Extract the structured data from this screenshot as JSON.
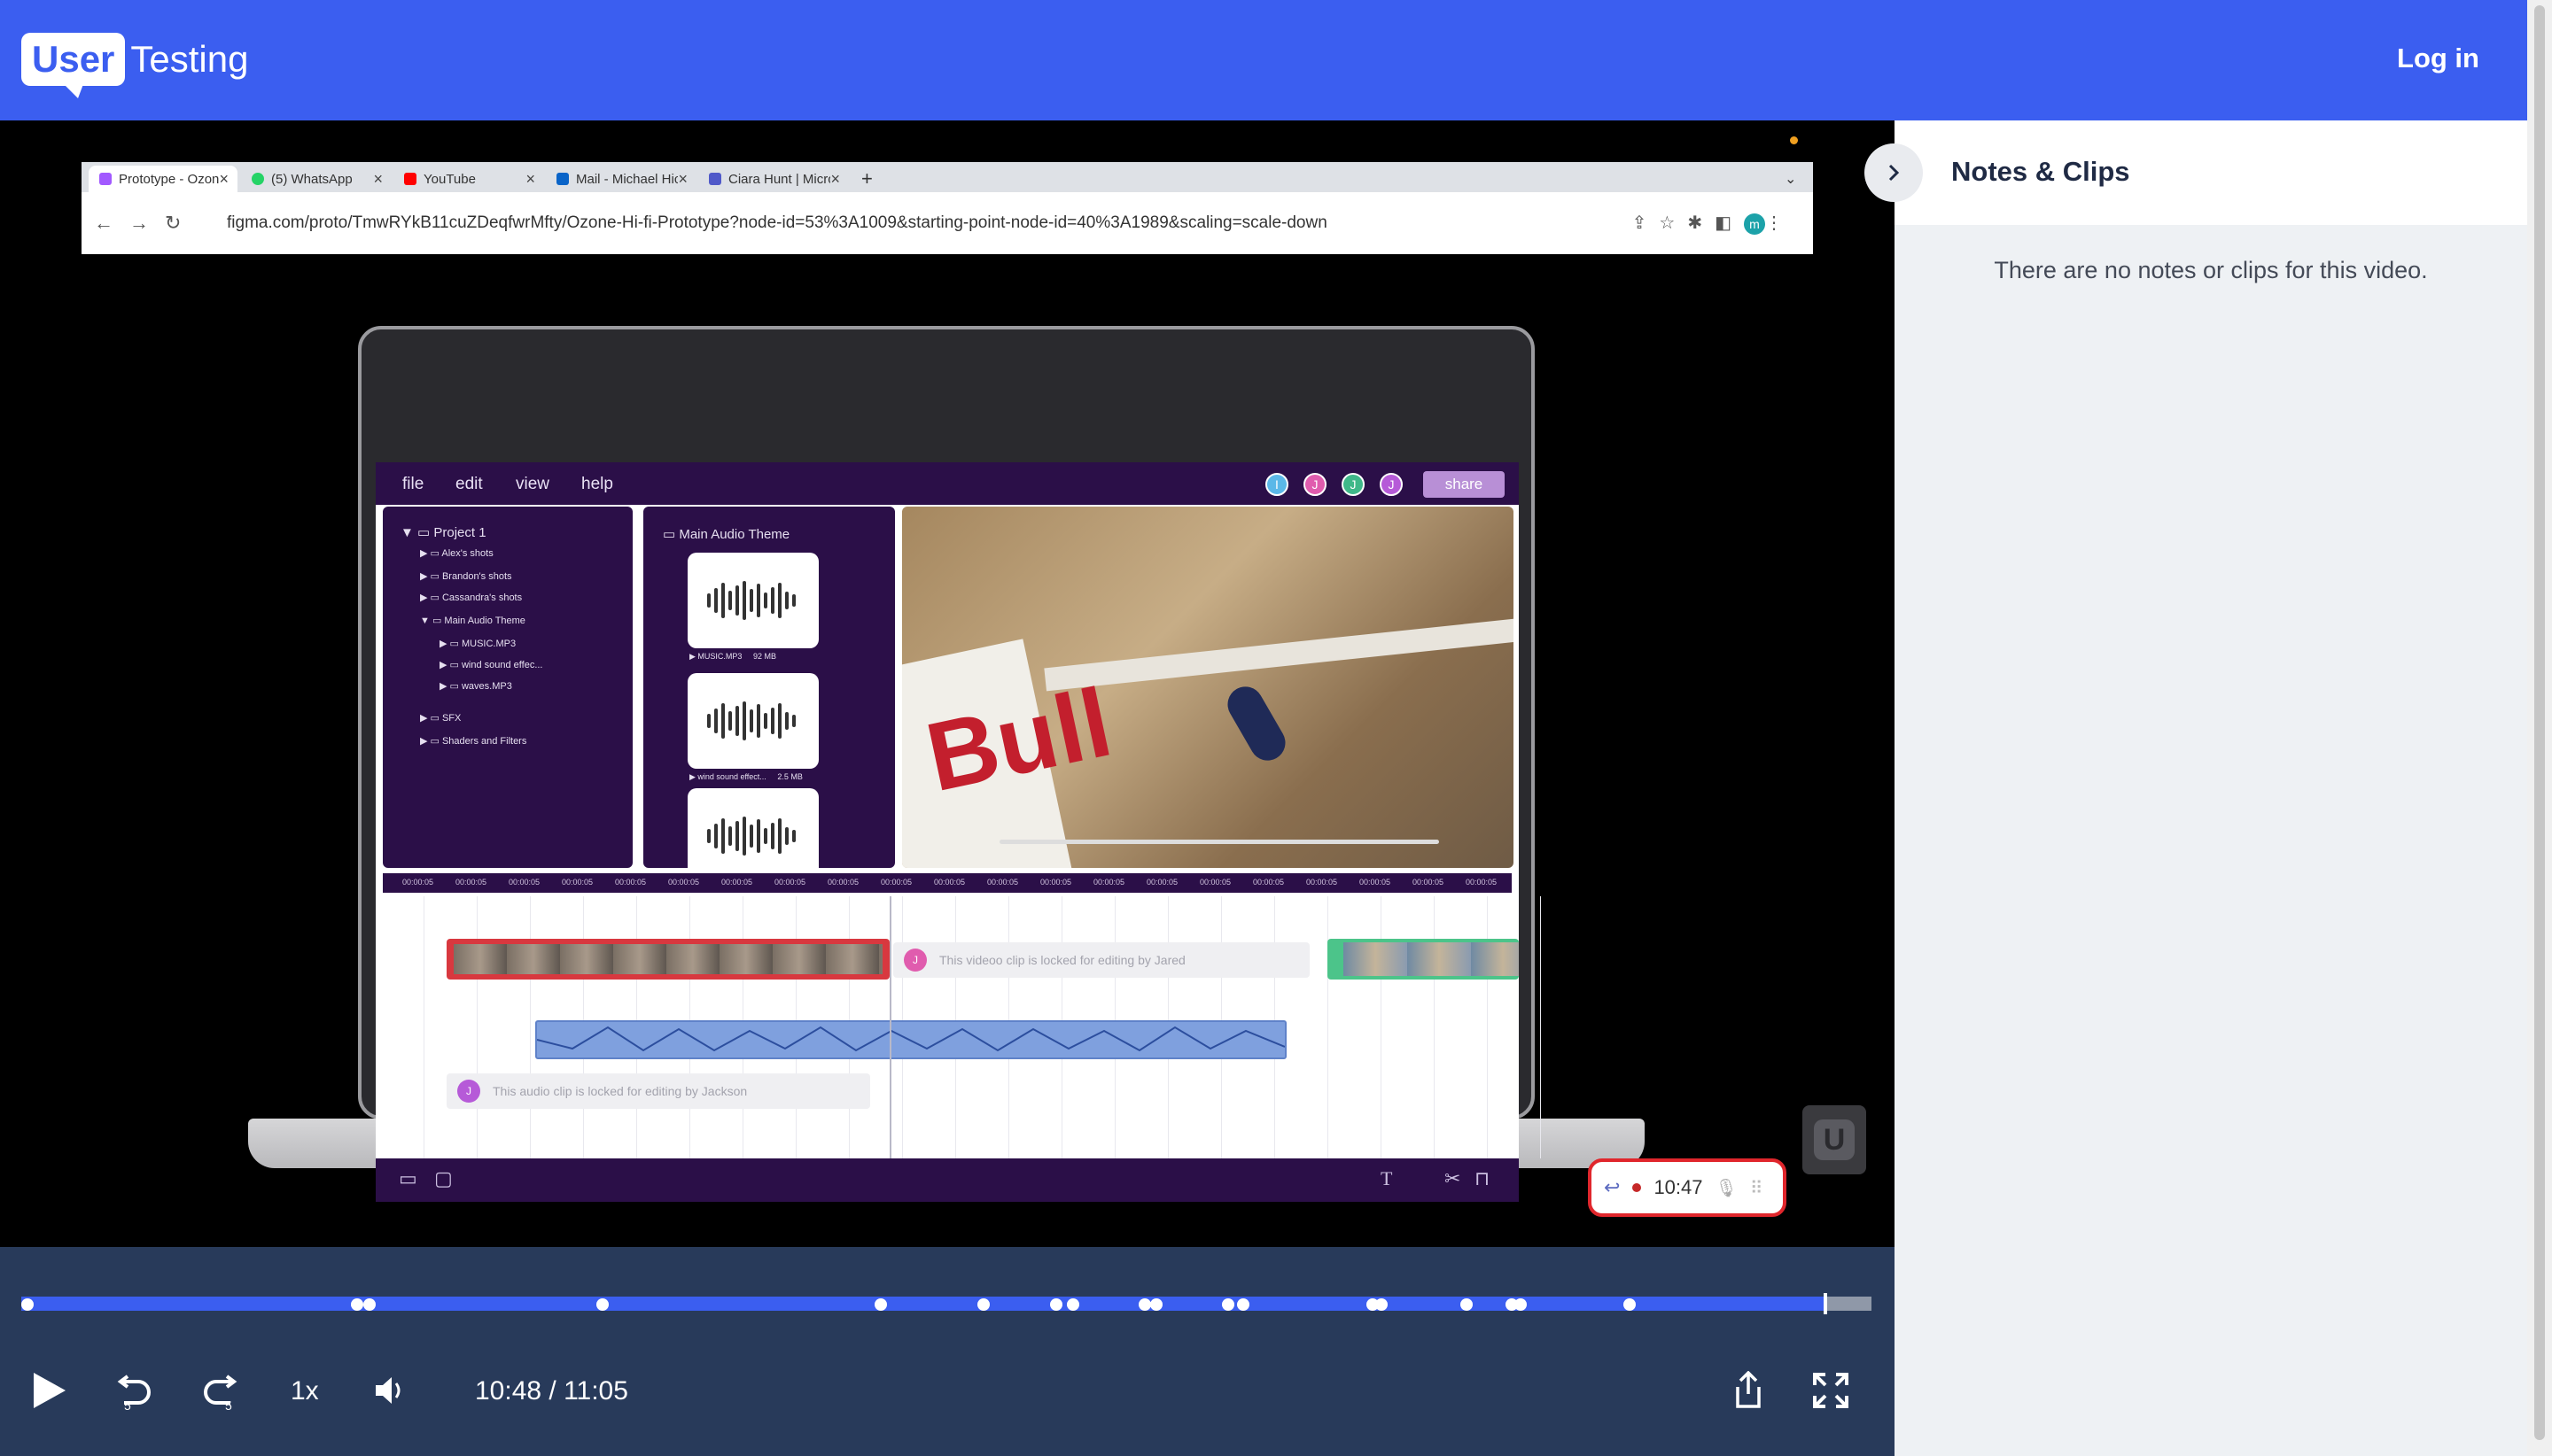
{
  "header": {
    "logo_user": "User",
    "logo_testing": "Testing",
    "login_label": "Log in"
  },
  "browser": {
    "tabs": [
      {
        "title": "Prototype - Ozone Hi-fi Prot",
        "icon": "figma-icon",
        "active": true
      },
      {
        "title": "(5) WhatsApp",
        "icon": "whatsapp-icon"
      },
      {
        "title": "YouTube",
        "icon": "youtube-icon"
      },
      {
        "title": "Mail - Michael Hickman - Outlo",
        "icon": "outlook-icon"
      },
      {
        "title": "Ciara Hunt | Microsoft Teams",
        "icon": "teams-icon"
      }
    ],
    "url": "figma.com/proto/TmwRYkB11cuZDeqfwrMfty/Ozone-Hi-fi-Prototype?node-id=53%3A1009&starting-point-node-id=40%3A1989&scaling=scale-down",
    "profile_initial": "m"
  },
  "app": {
    "menus": [
      "file",
      "edit",
      "view",
      "help"
    ],
    "avatars": [
      {
        "initial": "I",
        "color": "#5bb8e8"
      },
      {
        "initial": "J",
        "color": "#e05cae"
      },
      {
        "initial": "J",
        "color": "#3fb889"
      },
      {
        "initial": "J",
        "color": "#b65ad8"
      }
    ],
    "share_label": "share",
    "project_tree": [
      {
        "label": "Project 1",
        "level": 0,
        "arrow": "▼"
      },
      {
        "label": "Alex's shots",
        "level": 1,
        "arrow": "▶"
      },
      {
        "label": "Brandon's shots",
        "level": 1,
        "arrow": "▶"
      },
      {
        "label": "Cassandra's shots",
        "level": 1,
        "arrow": "▶"
      },
      {
        "label": "Main Audio Theme",
        "level": 1,
        "arrow": "▼"
      },
      {
        "label": "MUSIC.MP3",
        "level": 2,
        "arrow": "▶"
      },
      {
        "label": "wind sound effec...",
        "level": 2,
        "arrow": "▶"
      },
      {
        "label": "waves.MP3",
        "level": 2,
        "arrow": "▶"
      },
      {
        "label": "SFX",
        "level": 1,
        "arrow": "▶"
      },
      {
        "label": "Shaders and Filters",
        "level": 1,
        "arrow": "▶"
      }
    ],
    "audio_panel_title": "Main Audio Theme",
    "audio_files": [
      {
        "name": "MUSIC.MP3",
        "size": "92 MB"
      },
      {
        "name": "wind sound effect...",
        "size": "2.5 MB"
      },
      {
        "name": "",
        "size": ""
      }
    ],
    "preview_text": "Bull",
    "ruler_tick": "00:00:05",
    "locked_video_clip": {
      "text": "This videoo clip is locked for editing by Jared",
      "initial": "J",
      "color": "#e05cae"
    },
    "locked_audio_clip": {
      "text": "This audio clip is locked for editing by Jackson",
      "initial": "J",
      "color": "#b65ad8"
    }
  },
  "recorder": {
    "time": "10:47"
  },
  "player": {
    "speed": "1x",
    "current_time": "10:48",
    "duration": "11:05",
    "time_display": "10:48 / 11:05",
    "progress_fraction": 0.975,
    "marker_fractions": [
      0.0,
      0.178,
      0.185,
      0.311,
      0.461,
      0.517,
      0.556,
      0.565,
      0.604,
      0.61,
      0.649,
      0.657,
      0.727,
      0.732,
      0.778,
      0.802,
      0.807,
      0.866
    ]
  },
  "notes": {
    "title": "Notes & Clips",
    "empty_message": "There are no notes or clips for this video."
  }
}
